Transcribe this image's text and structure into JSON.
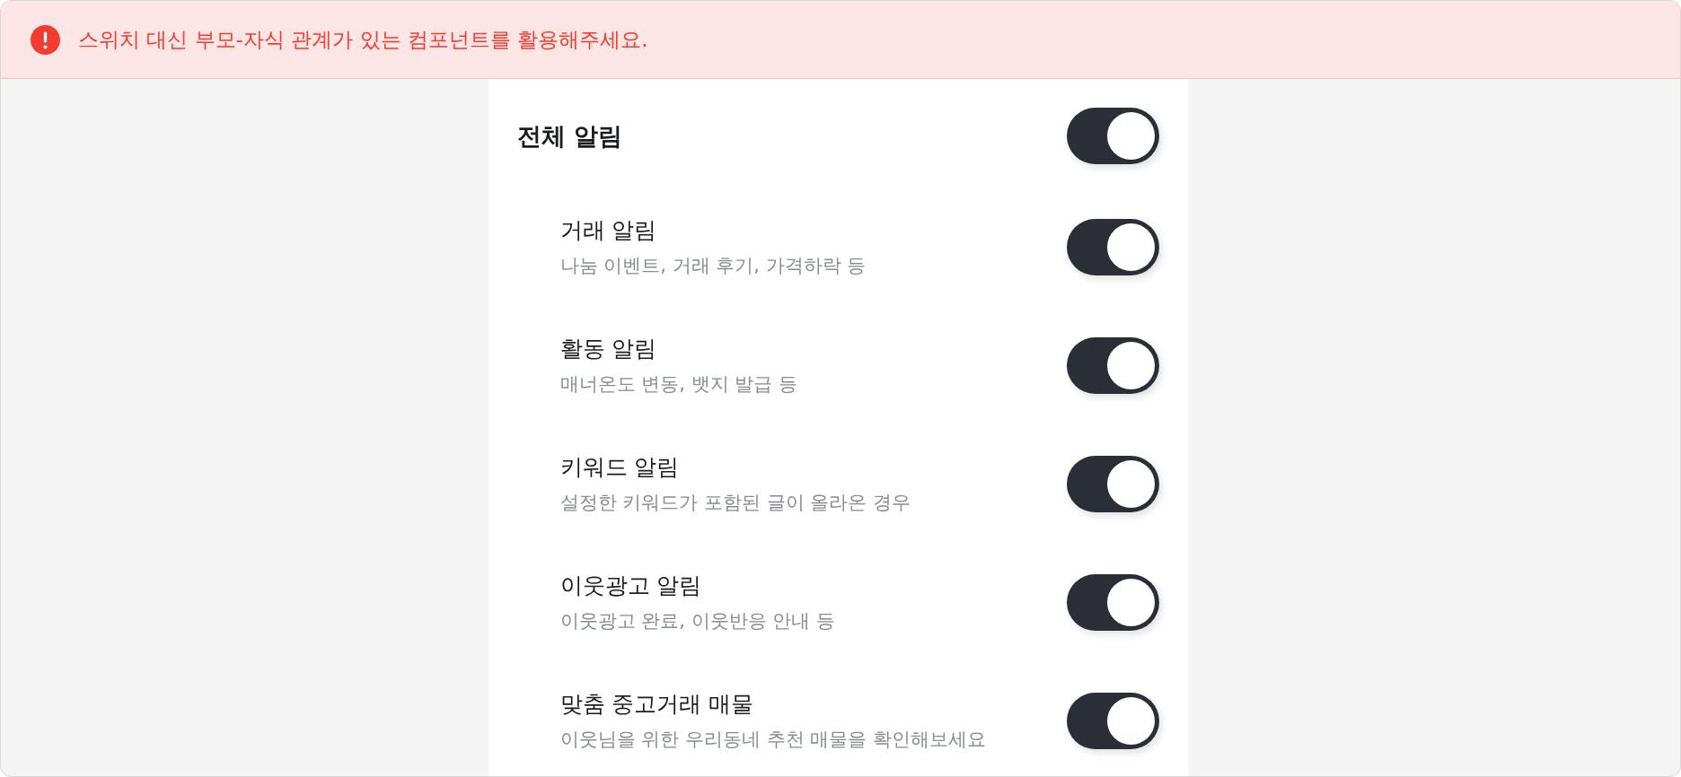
{
  "alert": {
    "message": "스위치 대신 부모-자식 관계가 있는 컴포넌트를 활용해주세요."
  },
  "master": {
    "label": "전체 알림",
    "on": true
  },
  "items": [
    {
      "title": "거래 알림",
      "description": "나눔 이벤트, 거래 후기, 가격하락 등",
      "on": true
    },
    {
      "title": "활동 알림",
      "description": "매너온도 변동, 뱃지 발급 등",
      "on": true
    },
    {
      "title": "키워드 알림",
      "description": "설정한 키워드가 포함된 글이 올라온 경우",
      "on": true
    },
    {
      "title": "이웃광고 알림",
      "description": "이웃광고 완료, 이웃반응 안내 등",
      "on": true
    },
    {
      "title": "맞춤 중고거래 매물",
      "description": "이웃님을 위한 우리동네 추천 매물을 확인해보세요",
      "on": true
    }
  ]
}
